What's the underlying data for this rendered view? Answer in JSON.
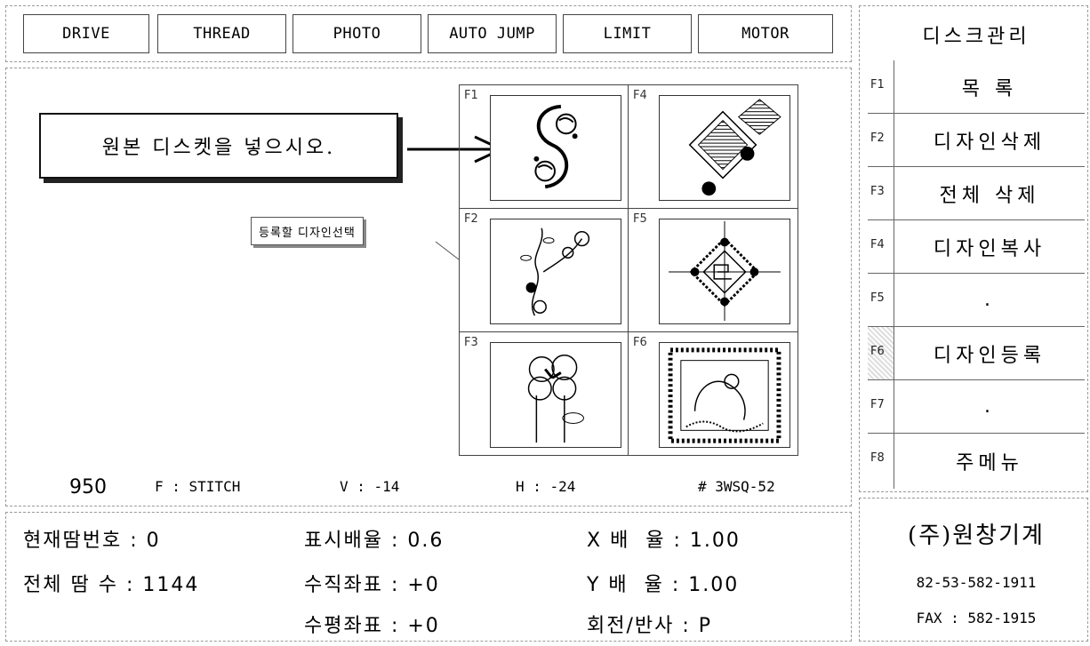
{
  "top_buttons": [
    "DRIVE",
    "THREAD",
    "PHOTO",
    "AUTO JUMP",
    "LIMIT",
    "MOTOR"
  ],
  "message": "원본 디스켓을 넣으시오.",
  "callout": "등록할 디자인선택",
  "design_slots": [
    "F1",
    "F2",
    "F3",
    "F4",
    "F5",
    "F6"
  ],
  "status": {
    "count": "950",
    "mode": "F : STITCH",
    "v": "V : -14",
    "h": "H : -24",
    "code": "# 3WSQ-52"
  },
  "info": {
    "r1c1": "현재땀번호 : 0",
    "r1c2": "표시배율 : 0.6",
    "r1c3": "X 배  율 : 1.00",
    "r2c1": "전체 땀 수 : 1144",
    "r2c2": "수직좌표 : +0",
    "r2c3": "Y 배  율 : 1.00",
    "r3c2": "수평좌표 : +0",
    "r3c3": "회전/반사 : P"
  },
  "sidebar": {
    "title": "디스크관리",
    "items": [
      {
        "key": "F1",
        "label": "목  록"
      },
      {
        "key": "F2",
        "label": "디자인삭제"
      },
      {
        "key": "F3",
        "label": "전체 삭제"
      },
      {
        "key": "F4",
        "label": "디자인복사"
      },
      {
        "key": "F5",
        "label": "."
      },
      {
        "key": "F6",
        "label": "디자인등록"
      },
      {
        "key": "F7",
        "label": "."
      },
      {
        "key": "F8",
        "label": "주메뉴"
      }
    ]
  },
  "company": {
    "name": "(주)원창기계",
    "phone": "82-53-582-1911",
    "fax": "FAX : 582-1915"
  }
}
